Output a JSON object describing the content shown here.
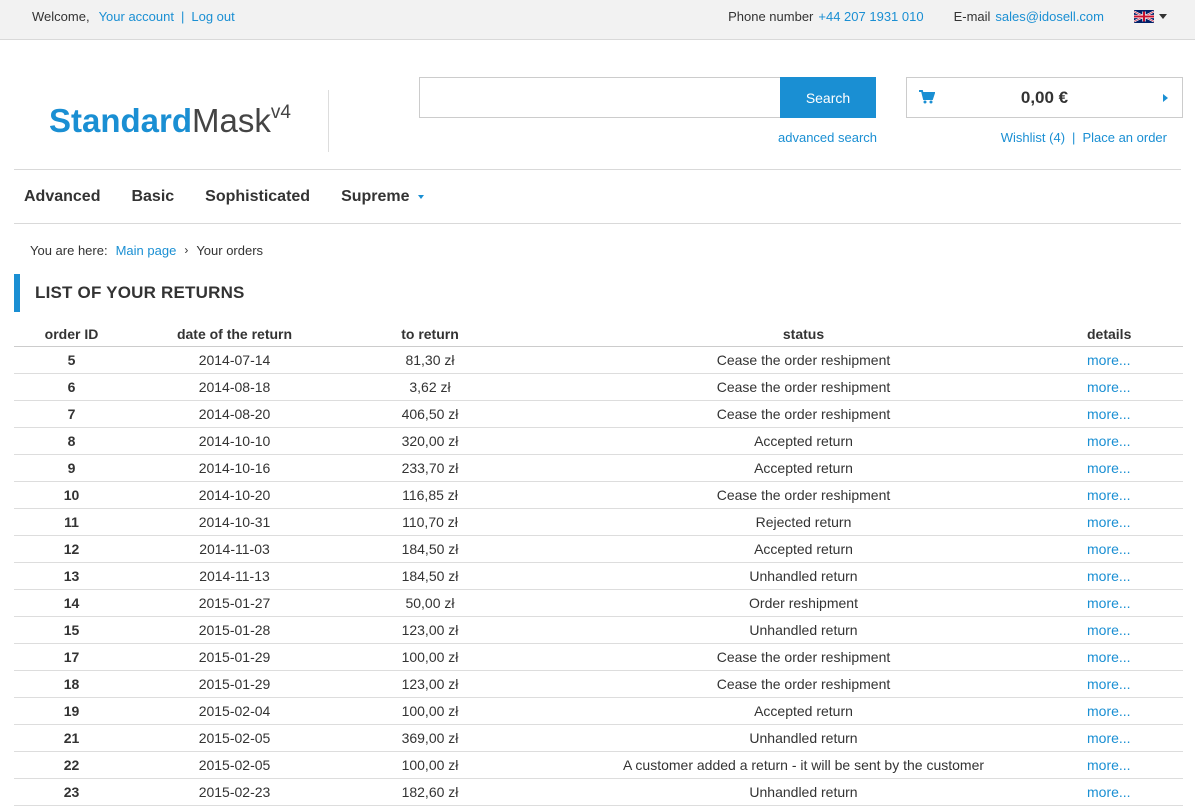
{
  "topbar": {
    "welcome": "Welcome,",
    "your_account": "Your account",
    "sep": "|",
    "logout": "Log out",
    "phone_label": "Phone number",
    "phone": "+44 207 1931 010",
    "email_label": "E-mail",
    "email": "sales@idosell.com",
    "language_icon": "uk-flag-icon"
  },
  "logo": {
    "part1": "Standard",
    "part2": "Mask",
    "sup": "v4"
  },
  "search": {
    "value": "",
    "placeholder": "",
    "button": "Search",
    "advanced": "advanced search"
  },
  "cart": {
    "total": "0,00 €",
    "wishlist": "Wishlist (4)",
    "sep": "|",
    "place_order": "Place an order"
  },
  "nav": {
    "items": [
      "Advanced",
      "Basic",
      "Sophisticated",
      "Supreme"
    ]
  },
  "breadcrumb": {
    "label": "You are here:",
    "home": "Main page",
    "current": "Your orders"
  },
  "section_title": "LIST OF YOUR RETURNS",
  "table": {
    "headers": [
      "order ID",
      "date of the return",
      "to return",
      "status",
      "details"
    ],
    "rows": [
      {
        "id": "5",
        "date": "2014-07-14",
        "amount": "81,30 zł",
        "status": "Cease the order reshipment",
        "details": "more..."
      },
      {
        "id": "6",
        "date": "2014-08-18",
        "amount": "3,62 zł",
        "status": "Cease the order reshipment",
        "details": "more..."
      },
      {
        "id": "7",
        "date": "2014-08-20",
        "amount": "406,50 zł",
        "status": "Cease the order reshipment",
        "details": "more..."
      },
      {
        "id": "8",
        "date": "2014-10-10",
        "amount": "320,00 zł",
        "status": "Accepted return",
        "details": "more..."
      },
      {
        "id": "9",
        "date": "2014-10-16",
        "amount": "233,70 zł",
        "status": "Accepted return",
        "details": "more..."
      },
      {
        "id": "10",
        "date": "2014-10-20",
        "amount": "116,85 zł",
        "status": "Cease the order reshipment",
        "details": "more..."
      },
      {
        "id": "11",
        "date": "2014-10-31",
        "amount": "110,70 zł",
        "status": "Rejected return",
        "details": "more..."
      },
      {
        "id": "12",
        "date": "2014-11-03",
        "amount": "184,50 zł",
        "status": "Accepted return",
        "details": "more..."
      },
      {
        "id": "13",
        "date": "2014-11-13",
        "amount": "184,50 zł",
        "status": "Unhandled return",
        "details": "more..."
      },
      {
        "id": "14",
        "date": "2015-01-27",
        "amount": "50,00 zł",
        "status": "Order reshipment",
        "details": "more..."
      },
      {
        "id": "15",
        "date": "2015-01-28",
        "amount": "123,00 zł",
        "status": "Unhandled return",
        "details": "more..."
      },
      {
        "id": "17",
        "date": "2015-01-29",
        "amount": "100,00 zł",
        "status": "Cease the order reshipment",
        "details": "more..."
      },
      {
        "id": "18",
        "date": "2015-01-29",
        "amount": "123,00 zł",
        "status": "Cease the order reshipment",
        "details": "more..."
      },
      {
        "id": "19",
        "date": "2015-02-04",
        "amount": "100,00 zł",
        "status": "Accepted return",
        "details": "more..."
      },
      {
        "id": "21",
        "date": "2015-02-05",
        "amount": "369,00 zł",
        "status": "Unhandled return",
        "details": "more..."
      },
      {
        "id": "22",
        "date": "2015-02-05",
        "amount": "100,00 zł",
        "status": "A customer added a return - it will be sent by the customer",
        "details": "more..."
      },
      {
        "id": "23",
        "date": "2015-02-23",
        "amount": "182,60 zł",
        "status": "Unhandled return",
        "details": "more..."
      }
    ]
  },
  "colors": {
    "accent": "#1a8fd3",
    "text": "#333333",
    "topbar_bg": "#f2f2f2"
  }
}
